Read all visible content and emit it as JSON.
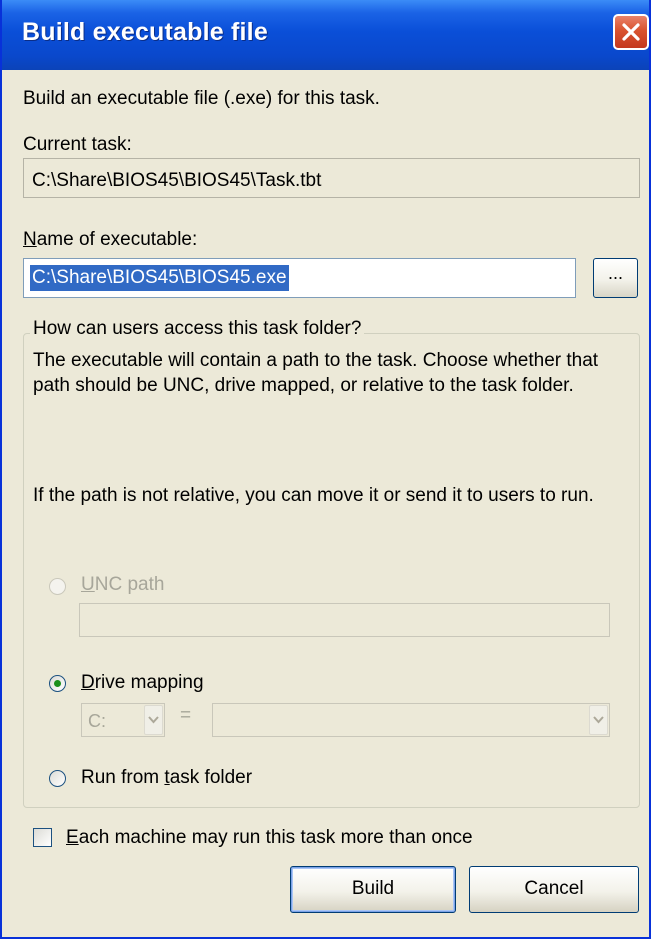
{
  "window": {
    "title": "Build executable file"
  },
  "intro": "Build an executable file (.exe) for this task.",
  "current_task": {
    "label": "Current task:",
    "value": "C:\\Share\\BIOS45\\BIOS45\\Task.tbt"
  },
  "name_of_executable": {
    "label_mnemonic": "N",
    "label_rest": "ame of executable:",
    "value": "C:\\Share\\BIOS45\\BIOS45.exe",
    "browse_label": "..."
  },
  "group": {
    "legend": "How can users access this task folder?",
    "description": "The executable will contain a path to the task. Choose whether that path should be UNC, drive mapped, or relative to the task folder.",
    "note": "If the path is not relative, you can move it or send it to users to run.",
    "options": {
      "unc": {
        "mnemonic": "U",
        "rest": "NC path",
        "enabled": false,
        "selected": false
      },
      "drive": {
        "mnemonic": "D",
        "rest": "rive mapping",
        "enabled": true,
        "selected": true
      },
      "run_from": {
        "before": "Run from ",
        "mnemonic": "t",
        "rest": "ask folder",
        "enabled": true,
        "selected": false
      }
    },
    "drive_letter": "C:",
    "equals": "="
  },
  "checkbox": {
    "mnemonic": "E",
    "rest": "ach machine may run this task more than once",
    "checked": false
  },
  "buttons": {
    "build": "Build",
    "cancel": "Cancel"
  }
}
